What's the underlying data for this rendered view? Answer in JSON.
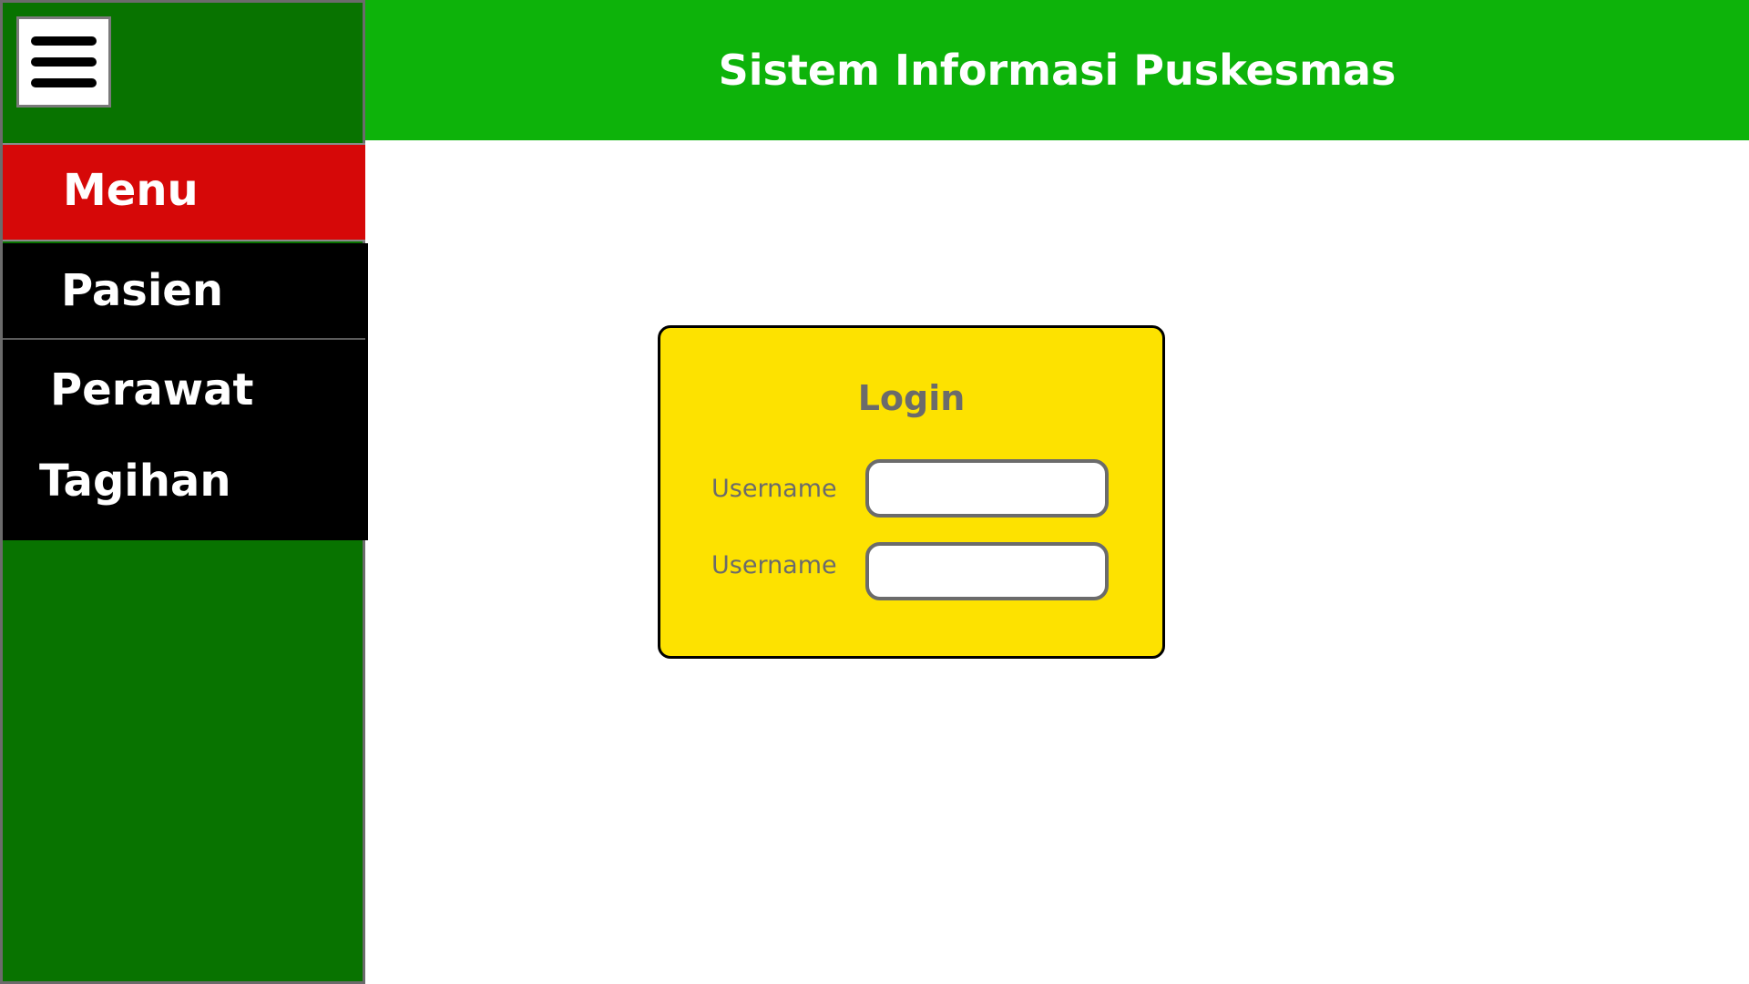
{
  "header": {
    "title": "Sistem Informasi Puskesmas"
  },
  "sidebar": {
    "menu_icon": "hamburger-icon",
    "menu_title": "Menu",
    "items": [
      {
        "label": "Pasien"
      },
      {
        "label": "Perawat"
      },
      {
        "label": "Tagihan"
      }
    ]
  },
  "login": {
    "title": "Login",
    "fields": [
      {
        "label": "Username",
        "value": "",
        "placeholder": ""
      },
      {
        "label": "Username",
        "value": "",
        "placeholder": ""
      }
    ]
  },
  "colors": {
    "header_bg": "#0db30a",
    "sidebar_bg": "#087300",
    "menu_header_bg": "#d60808",
    "nav_bg": "#000000",
    "card_bg": "#fde200"
  }
}
